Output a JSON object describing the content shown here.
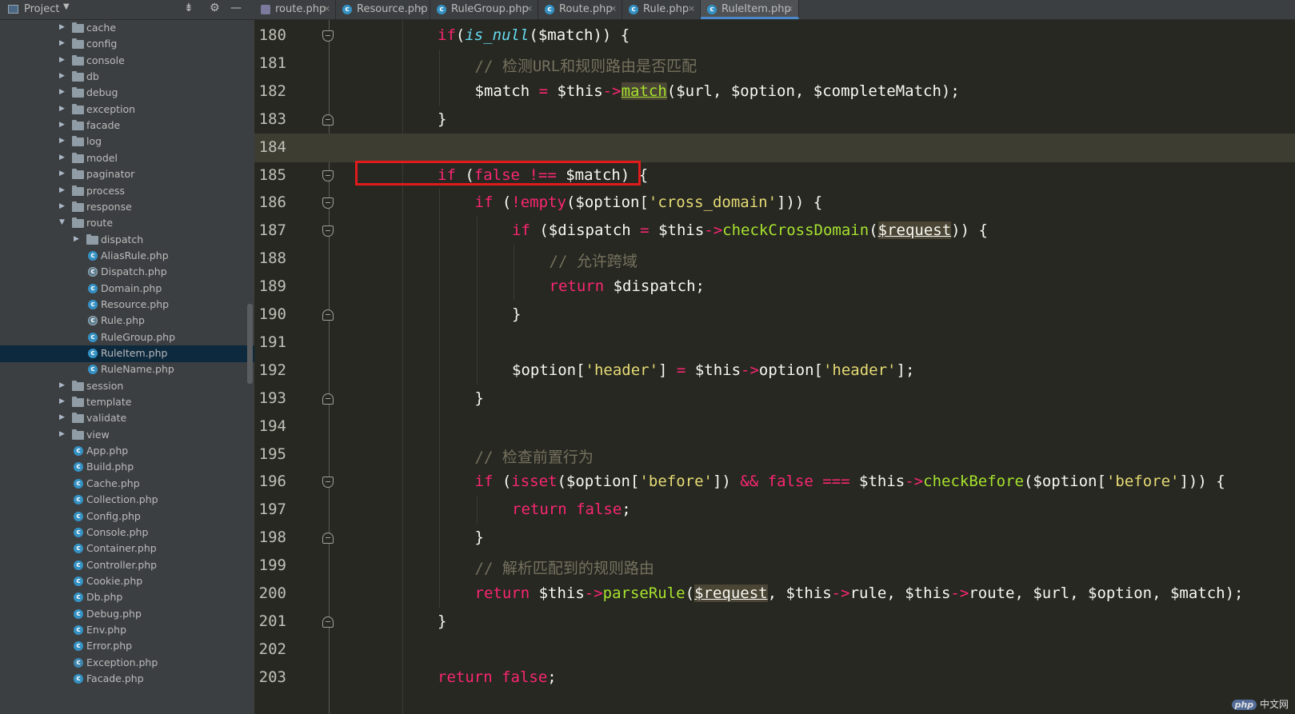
{
  "sidebar": {
    "title": "Project",
    "rows": [
      {
        "name": "cache",
        "type": "folder",
        "expanded": false,
        "depth": 0
      },
      {
        "name": "config",
        "type": "folder",
        "expanded": false,
        "depth": 0
      },
      {
        "name": "console",
        "type": "folder",
        "expanded": false,
        "depth": 0
      },
      {
        "name": "db",
        "type": "folder",
        "expanded": false,
        "depth": 0
      },
      {
        "name": "debug",
        "type": "folder",
        "expanded": false,
        "depth": 0
      },
      {
        "name": "exception",
        "type": "folder",
        "expanded": false,
        "depth": 0
      },
      {
        "name": "facade",
        "type": "folder",
        "expanded": false,
        "depth": 0
      },
      {
        "name": "log",
        "type": "folder",
        "expanded": false,
        "depth": 0
      },
      {
        "name": "model",
        "type": "folder",
        "expanded": false,
        "depth": 0
      },
      {
        "name": "paginator",
        "type": "folder",
        "expanded": false,
        "depth": 0
      },
      {
        "name": "process",
        "type": "folder",
        "expanded": false,
        "depth": 0
      },
      {
        "name": "response",
        "type": "folder",
        "expanded": false,
        "depth": 0
      },
      {
        "name": "route",
        "type": "folder",
        "expanded": true,
        "depth": 0
      },
      {
        "name": "dispatch",
        "type": "folder",
        "expanded": false,
        "depth": 1
      },
      {
        "name": "AliasRule.php",
        "type": "class",
        "depth": 1
      },
      {
        "name": "Dispatch.php",
        "type": "abstract",
        "depth": 1
      },
      {
        "name": "Domain.php",
        "type": "class",
        "depth": 1
      },
      {
        "name": "Resource.php",
        "type": "class",
        "depth": 1
      },
      {
        "name": "Rule.php",
        "type": "abstract",
        "depth": 1
      },
      {
        "name": "RuleGroup.php",
        "type": "class",
        "depth": 1
      },
      {
        "name": "RuleItem.php",
        "type": "class",
        "depth": 1,
        "selected": true
      },
      {
        "name": "RuleName.php",
        "type": "class",
        "depth": 1
      },
      {
        "name": "session",
        "type": "folder",
        "expanded": false,
        "depth": 0
      },
      {
        "name": "template",
        "type": "folder",
        "expanded": false,
        "depth": 0
      },
      {
        "name": "validate",
        "type": "folder",
        "expanded": false,
        "depth": 0
      },
      {
        "name": "view",
        "type": "folder",
        "expanded": false,
        "depth": 0
      },
      {
        "name": "App.php",
        "type": "class",
        "depth": 0
      },
      {
        "name": "Build.php",
        "type": "class",
        "depth": 0
      },
      {
        "name": "Cache.php",
        "type": "class",
        "depth": 0
      },
      {
        "name": "Collection.php",
        "type": "class",
        "depth": 0
      },
      {
        "name": "Config.php",
        "type": "class",
        "depth": 0
      },
      {
        "name": "Console.php",
        "type": "class",
        "depth": 0
      },
      {
        "name": "Container.php",
        "type": "class",
        "depth": 0
      },
      {
        "name": "Controller.php",
        "type": "class",
        "depth": 0
      },
      {
        "name": "Cookie.php",
        "type": "class",
        "depth": 0
      },
      {
        "name": "Db.php",
        "type": "class",
        "depth": 0
      },
      {
        "name": "Debug.php",
        "type": "class",
        "depth": 0
      },
      {
        "name": "Env.php",
        "type": "class",
        "depth": 0
      },
      {
        "name": "Error.php",
        "type": "class",
        "depth": 0
      },
      {
        "name": "Exception.php",
        "type": "exception",
        "depth": 0
      },
      {
        "name": "Facade.php",
        "type": "class",
        "depth": 0
      }
    ]
  },
  "tabs": [
    {
      "label": "route.php",
      "icon": "php-file-icon",
      "active": false
    },
    {
      "label": "Resource.php",
      "icon": "class-icon",
      "active": false
    },
    {
      "label": "RuleGroup.php",
      "icon": "class-icon",
      "active": false
    },
    {
      "label": "Route.php",
      "icon": "class-icon",
      "active": false
    },
    {
      "label": "Rule.php",
      "icon": "abstract-class-icon",
      "active": false
    },
    {
      "label": "RuleItem.php",
      "icon": "class-icon",
      "active": true
    }
  ],
  "tab_close_glyph": "×",
  "editor": {
    "current_line": 184,
    "highlighted_line": 185,
    "lines": [
      {
        "n": 180,
        "indent": 2,
        "fold": "open",
        "tokens": [
          [
            "kw",
            "if"
          ],
          [
            "",
            "("
          ],
          [
            "fni",
            "is_null"
          ],
          [
            "",
            "($match)) {"
          ]
        ]
      },
      {
        "n": 181,
        "indent": 3,
        "fold": "",
        "tokens": [
          [
            "cm",
            "// 检测URL和规则路由是否匹配"
          ]
        ]
      },
      {
        "n": 182,
        "indent": 3,
        "fold": "",
        "tokens": [
          [
            "",
            "$match "
          ],
          [
            "op",
            "="
          ],
          [
            "",
            " $this"
          ],
          [
            "op",
            "->"
          ],
          [
            "hlfn",
            "match"
          ],
          [
            "",
            "($url, $option, $completeMatch);"
          ]
        ]
      },
      {
        "n": 183,
        "indent": 2,
        "fold": "close",
        "tokens": [
          [
            "",
            "}"
          ]
        ]
      },
      {
        "n": 184,
        "indent": 0,
        "fold": "",
        "tokens": []
      },
      {
        "n": 185,
        "indent": 2,
        "fold": "open",
        "tokens": [
          [
            "kw",
            "if"
          ],
          [
            "",
            " ("
          ],
          [
            "kw",
            "false"
          ],
          [
            "",
            " "
          ],
          [
            "op",
            "!=="
          ],
          [
            "",
            " $match) {"
          ]
        ]
      },
      {
        "n": 186,
        "indent": 3,
        "fold": "open",
        "tokens": [
          [
            "kw",
            "if"
          ],
          [
            "",
            " ("
          ],
          [
            "op",
            "!"
          ],
          [
            "kw",
            "empty"
          ],
          [
            "",
            "($option["
          ],
          [
            "str",
            "'cross_domain'"
          ],
          [
            "",
            "])) {"
          ]
        ]
      },
      {
        "n": 187,
        "indent": 4,
        "fold": "open",
        "tokens": [
          [
            "kw",
            "if"
          ],
          [
            "",
            " ($dispatch "
          ],
          [
            "op",
            "="
          ],
          [
            "",
            " $this"
          ],
          [
            "op",
            "->"
          ],
          [
            "fn",
            "checkCrossDomain"
          ],
          [
            "",
            "("
          ],
          [
            "hl",
            "$request"
          ],
          [
            "",
            ")) {"
          ]
        ]
      },
      {
        "n": 188,
        "indent": 5,
        "fold": "",
        "tokens": [
          [
            "cm",
            "// 允许跨域"
          ]
        ]
      },
      {
        "n": 189,
        "indent": 5,
        "fold": "",
        "tokens": [
          [
            "kw",
            "return"
          ],
          [
            "",
            " $dispatch;"
          ]
        ]
      },
      {
        "n": 190,
        "indent": 4,
        "fold": "close",
        "tokens": [
          [
            "",
            "}"
          ]
        ]
      },
      {
        "n": 191,
        "indent": 0,
        "fold": "",
        "tokens": []
      },
      {
        "n": 192,
        "indent": 4,
        "fold": "",
        "tokens": [
          [
            "",
            "$option["
          ],
          [
            "str",
            "'header'"
          ],
          [
            "",
            "] "
          ],
          [
            "op",
            "="
          ],
          [
            "",
            " $this"
          ],
          [
            "op",
            "->"
          ],
          [
            "",
            "option["
          ],
          [
            "str",
            "'header'"
          ],
          [
            "",
            "];"
          ]
        ]
      },
      {
        "n": 193,
        "indent": 3,
        "fold": "close",
        "tokens": [
          [
            "",
            "}"
          ]
        ]
      },
      {
        "n": 194,
        "indent": 0,
        "fold": "",
        "tokens": []
      },
      {
        "n": 195,
        "indent": 3,
        "fold": "",
        "tokens": [
          [
            "cm",
            "// 检查前置行为"
          ]
        ]
      },
      {
        "n": 196,
        "indent": 3,
        "fold": "open",
        "tokens": [
          [
            "kw",
            "if"
          ],
          [
            "",
            " ("
          ],
          [
            "kw",
            "isset"
          ],
          [
            "",
            "($option["
          ],
          [
            "str",
            "'before'"
          ],
          [
            "",
            "]) "
          ],
          [
            "op",
            "&&"
          ],
          [
            "",
            " "
          ],
          [
            "kw",
            "false"
          ],
          [
            "",
            " "
          ],
          [
            "op",
            "==="
          ],
          [
            "",
            " $this"
          ],
          [
            "op",
            "->"
          ],
          [
            "fn",
            "checkBefore"
          ],
          [
            "",
            "($option["
          ],
          [
            "str",
            "'before'"
          ],
          [
            "",
            "])) {"
          ]
        ]
      },
      {
        "n": 197,
        "indent": 4,
        "fold": "",
        "tokens": [
          [
            "kw",
            "return"
          ],
          [
            "",
            " "
          ],
          [
            "kw",
            "false"
          ],
          [
            "",
            ";"
          ]
        ]
      },
      {
        "n": 198,
        "indent": 3,
        "fold": "close",
        "tokens": [
          [
            "",
            "}"
          ]
        ]
      },
      {
        "n": 199,
        "indent": 3,
        "fold": "",
        "tokens": [
          [
            "cm",
            "// 解析匹配到的规则路由"
          ]
        ]
      },
      {
        "n": 200,
        "indent": 3,
        "fold": "",
        "tokens": [
          [
            "kw",
            "return"
          ],
          [
            "",
            " $this"
          ],
          [
            "op",
            "->"
          ],
          [
            "fn",
            "parseRule"
          ],
          [
            "",
            "("
          ],
          [
            "hl",
            "$request"
          ],
          [
            "",
            ", $this"
          ],
          [
            "op",
            "->"
          ],
          [
            "",
            "rule, $this"
          ],
          [
            "op",
            "->"
          ],
          [
            "",
            "route, $url, $option, $match);"
          ]
        ]
      },
      {
        "n": 201,
        "indent": 2,
        "fold": "close",
        "tokens": [
          [
            "",
            "}"
          ]
        ]
      },
      {
        "n": 202,
        "indent": 0,
        "fold": "",
        "tokens": []
      },
      {
        "n": 203,
        "indent": 2,
        "fold": "",
        "tokens": [
          [
            "kw",
            "return"
          ],
          [
            "",
            " "
          ],
          [
            "kw",
            "false"
          ],
          [
            "",
            ";"
          ]
        ]
      }
    ]
  },
  "watermark": {
    "badge": "php",
    "text": "中文网"
  },
  "colors": {
    "keyword": "#f92672",
    "function": "#a6e22e",
    "string": "#e6db74",
    "comment": "#75715e",
    "accent": "#4a88c7",
    "highlight_box": "#e01b1b"
  }
}
